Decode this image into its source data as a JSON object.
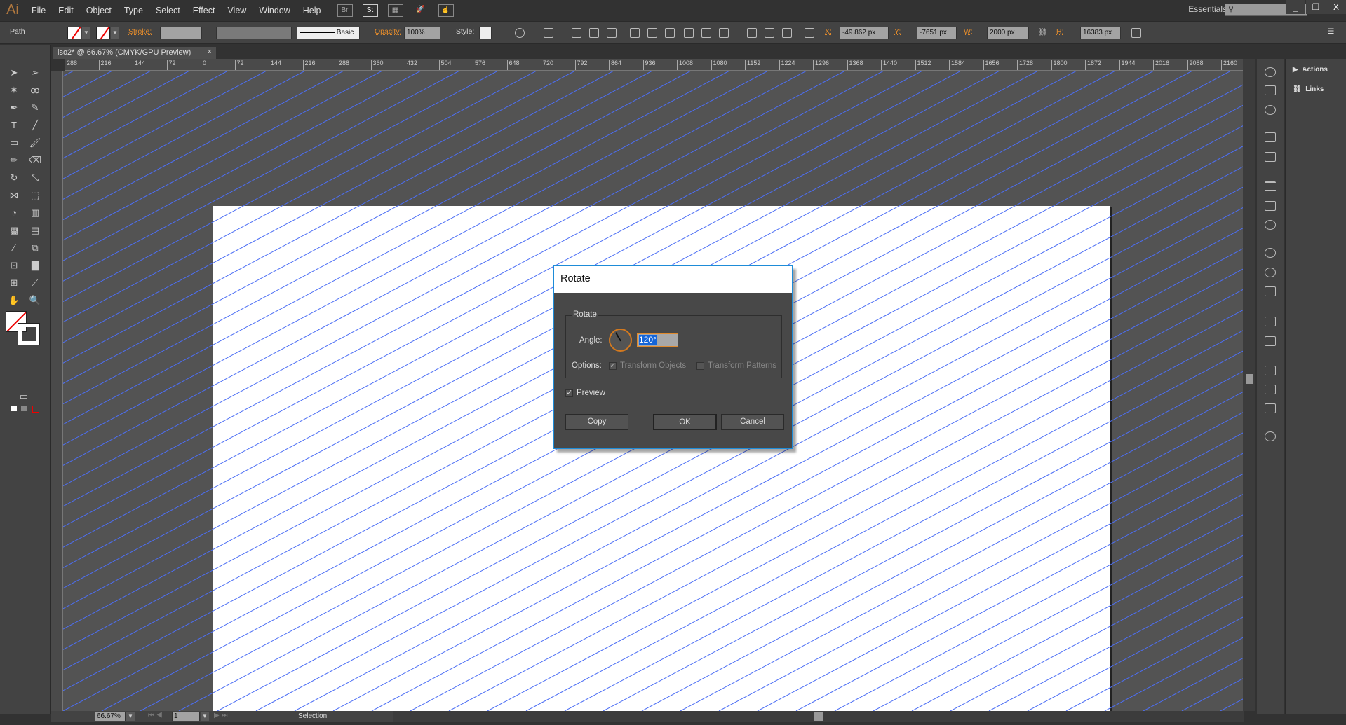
{
  "app": {
    "logo": "Ai",
    "menus": [
      "File",
      "Edit",
      "Object",
      "Type",
      "Select",
      "Effect",
      "View",
      "Window",
      "Help"
    ],
    "bridge": "Br",
    "stock": "St",
    "workspace": "Essentials",
    "window_controls": [
      "_",
      "❐",
      "X"
    ]
  },
  "control": {
    "selection": "Path",
    "stroke_label": "Stroke:",
    "brush": "Basic",
    "opacity_label": "Opacity:",
    "opacity": "100%",
    "style_label": "Style:",
    "x_label": "X:",
    "x": "-49.862 px",
    "y_label": "Y:",
    "y": "-7651 px",
    "w_label": "W:",
    "w": "2000 px",
    "h_label": "H:",
    "h": "16383 px"
  },
  "document": {
    "tab": "iso2* @ 66.67% (CMYK/GPU Preview)",
    "close": "×"
  },
  "ruler": {
    "h": [
      "288",
      "216",
      "144",
      "72",
      "0",
      "72",
      "144",
      "216",
      "288",
      "360",
      "432",
      "504",
      "576",
      "648",
      "720",
      "792",
      "864",
      "936",
      "1008",
      "1080",
      "1152",
      "1224",
      "1296",
      "1368",
      "1440",
      "1512",
      "1584",
      "1656",
      "1728",
      "1800",
      "1872",
      "1944",
      "2016",
      "2088",
      "2160"
    ]
  },
  "panels": {
    "actions": "Actions",
    "links": "Links"
  },
  "status": {
    "zoom": "66.67%",
    "artboard": "1",
    "tool": "Selection"
  },
  "dialog": {
    "title": "Rotate",
    "group": "Rotate",
    "angle_label": "Angle:",
    "angle": "120°",
    "options_label": "Options:",
    "transform_objects": "Transform Objects",
    "transform_patterns": "Transform Patterns",
    "preview": "Preview",
    "copy": "Copy",
    "ok": "OK",
    "cancel": "Cancel",
    "preview_checked": true,
    "transform_objects_checked": true,
    "transform_patterns_checked": false
  },
  "colors": {
    "accent": "#e08a2c",
    "guide_lines": "#4d6ff5",
    "dialog_border": "#1e8cd8"
  }
}
